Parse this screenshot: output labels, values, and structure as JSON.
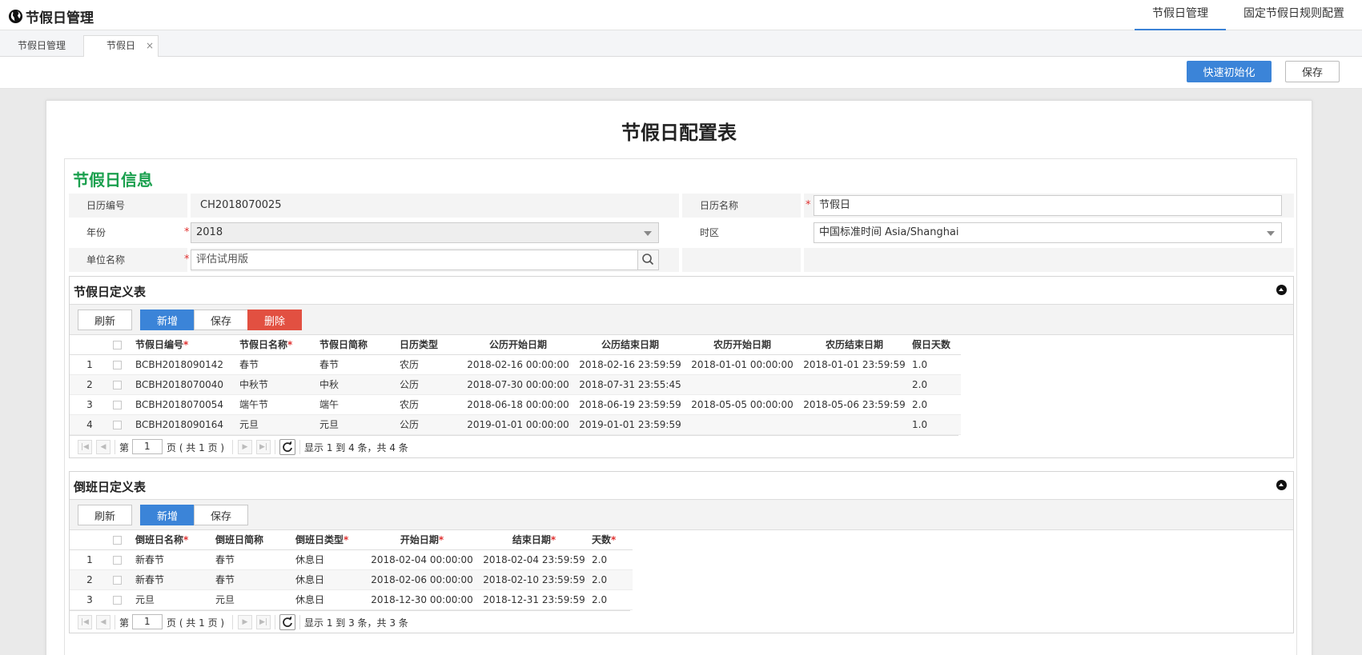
{
  "header": {
    "app_title": "节假日管理",
    "nav": [
      "节假日管理",
      "固定节假日规则配置"
    ]
  },
  "tabs": [
    {
      "label": "节假日管理"
    },
    {
      "label": "节假日",
      "close": "×"
    }
  ],
  "actions": {
    "quick_init": "快速初始化",
    "save": "保存"
  },
  "page_title": "节假日配置表",
  "info": {
    "section_title": "节假日信息",
    "calendar_code_label": "日历编号",
    "calendar_code": "CH2018070025",
    "calendar_name_label": "日历名称",
    "calendar_name": "节假日",
    "year_label": "年份",
    "year": "2018",
    "timezone_label": "时区",
    "timezone": "中国标准时间 Asia/Shanghai",
    "unit_label": "单位名称",
    "unit_placeholder": "评估试用版",
    "required_mark": "*"
  },
  "holiday_table": {
    "title": "节假日定义表",
    "buttons": {
      "refresh": "刷新",
      "add": "新增",
      "save": "保存",
      "delete": "删除"
    },
    "columns": [
      "节假日编号",
      "节假日名称",
      "节假日简称",
      "日历类型",
      "公历开始日期",
      "公历结束日期",
      "农历开始日期",
      "农历结束日期",
      "假日天数"
    ],
    "rows": [
      [
        "1",
        "BCBH2018090142",
        "春节",
        "春节",
        "农历",
        "2018-02-16 00:00:00",
        "2018-02-16 23:59:59",
        "2018-01-01 00:00:00",
        "2018-01-01 23:59:59",
        "1.0"
      ],
      [
        "2",
        "BCBH2018070040",
        "中秋节",
        "中秋",
        "公历",
        "2018-07-30 00:00:00",
        "2018-07-31 23:55:45",
        "",
        "",
        "2.0"
      ],
      [
        "3",
        "BCBH2018070054",
        "端午节",
        "端午",
        "农历",
        "2018-06-18 00:00:00",
        "2018-06-19 23:59:59",
        "2018-05-05 00:00:00",
        "2018-05-06 23:59:59",
        "2.0"
      ],
      [
        "4",
        "BCBH2018090164",
        "元旦",
        "元旦",
        "公历",
        "2019-01-01 00:00:00",
        "2019-01-01 23:59:59",
        "",
        "",
        "1.0"
      ]
    ],
    "pager": {
      "page_prefix": "第",
      "page": "1",
      "page_suffix": "页 ( 共 1 页 )",
      "summary": "显示 1 到 4 条，共 4 条"
    }
  },
  "shift_table": {
    "title": "倒班日定义表",
    "buttons": {
      "refresh": "刷新",
      "add": "新增",
      "save": "保存"
    },
    "columns": [
      "倒班日名称",
      "倒班日简称",
      "倒班日类型",
      "开始日期",
      "结束日期",
      "天数"
    ],
    "rows": [
      [
        "1",
        "新春节",
        "春节",
        "休息日",
        "2018-02-04 00:00:00",
        "2018-02-04 23:59:59",
        "2.0"
      ],
      [
        "2",
        "新春节",
        "春节",
        "休息日",
        "2018-02-06 00:00:00",
        "2018-02-10 23:59:59",
        "2.0"
      ],
      [
        "3",
        "元旦",
        "元旦",
        "休息日",
        "2018-12-30 00:00:00",
        "2018-12-31 23:59:59",
        "2.0"
      ]
    ],
    "pager": {
      "page_prefix": "第",
      "page": "1",
      "page_suffix": "页 ( 共 1 页 )",
      "summary": "显示 1 到 3 条，共 3 条"
    }
  }
}
